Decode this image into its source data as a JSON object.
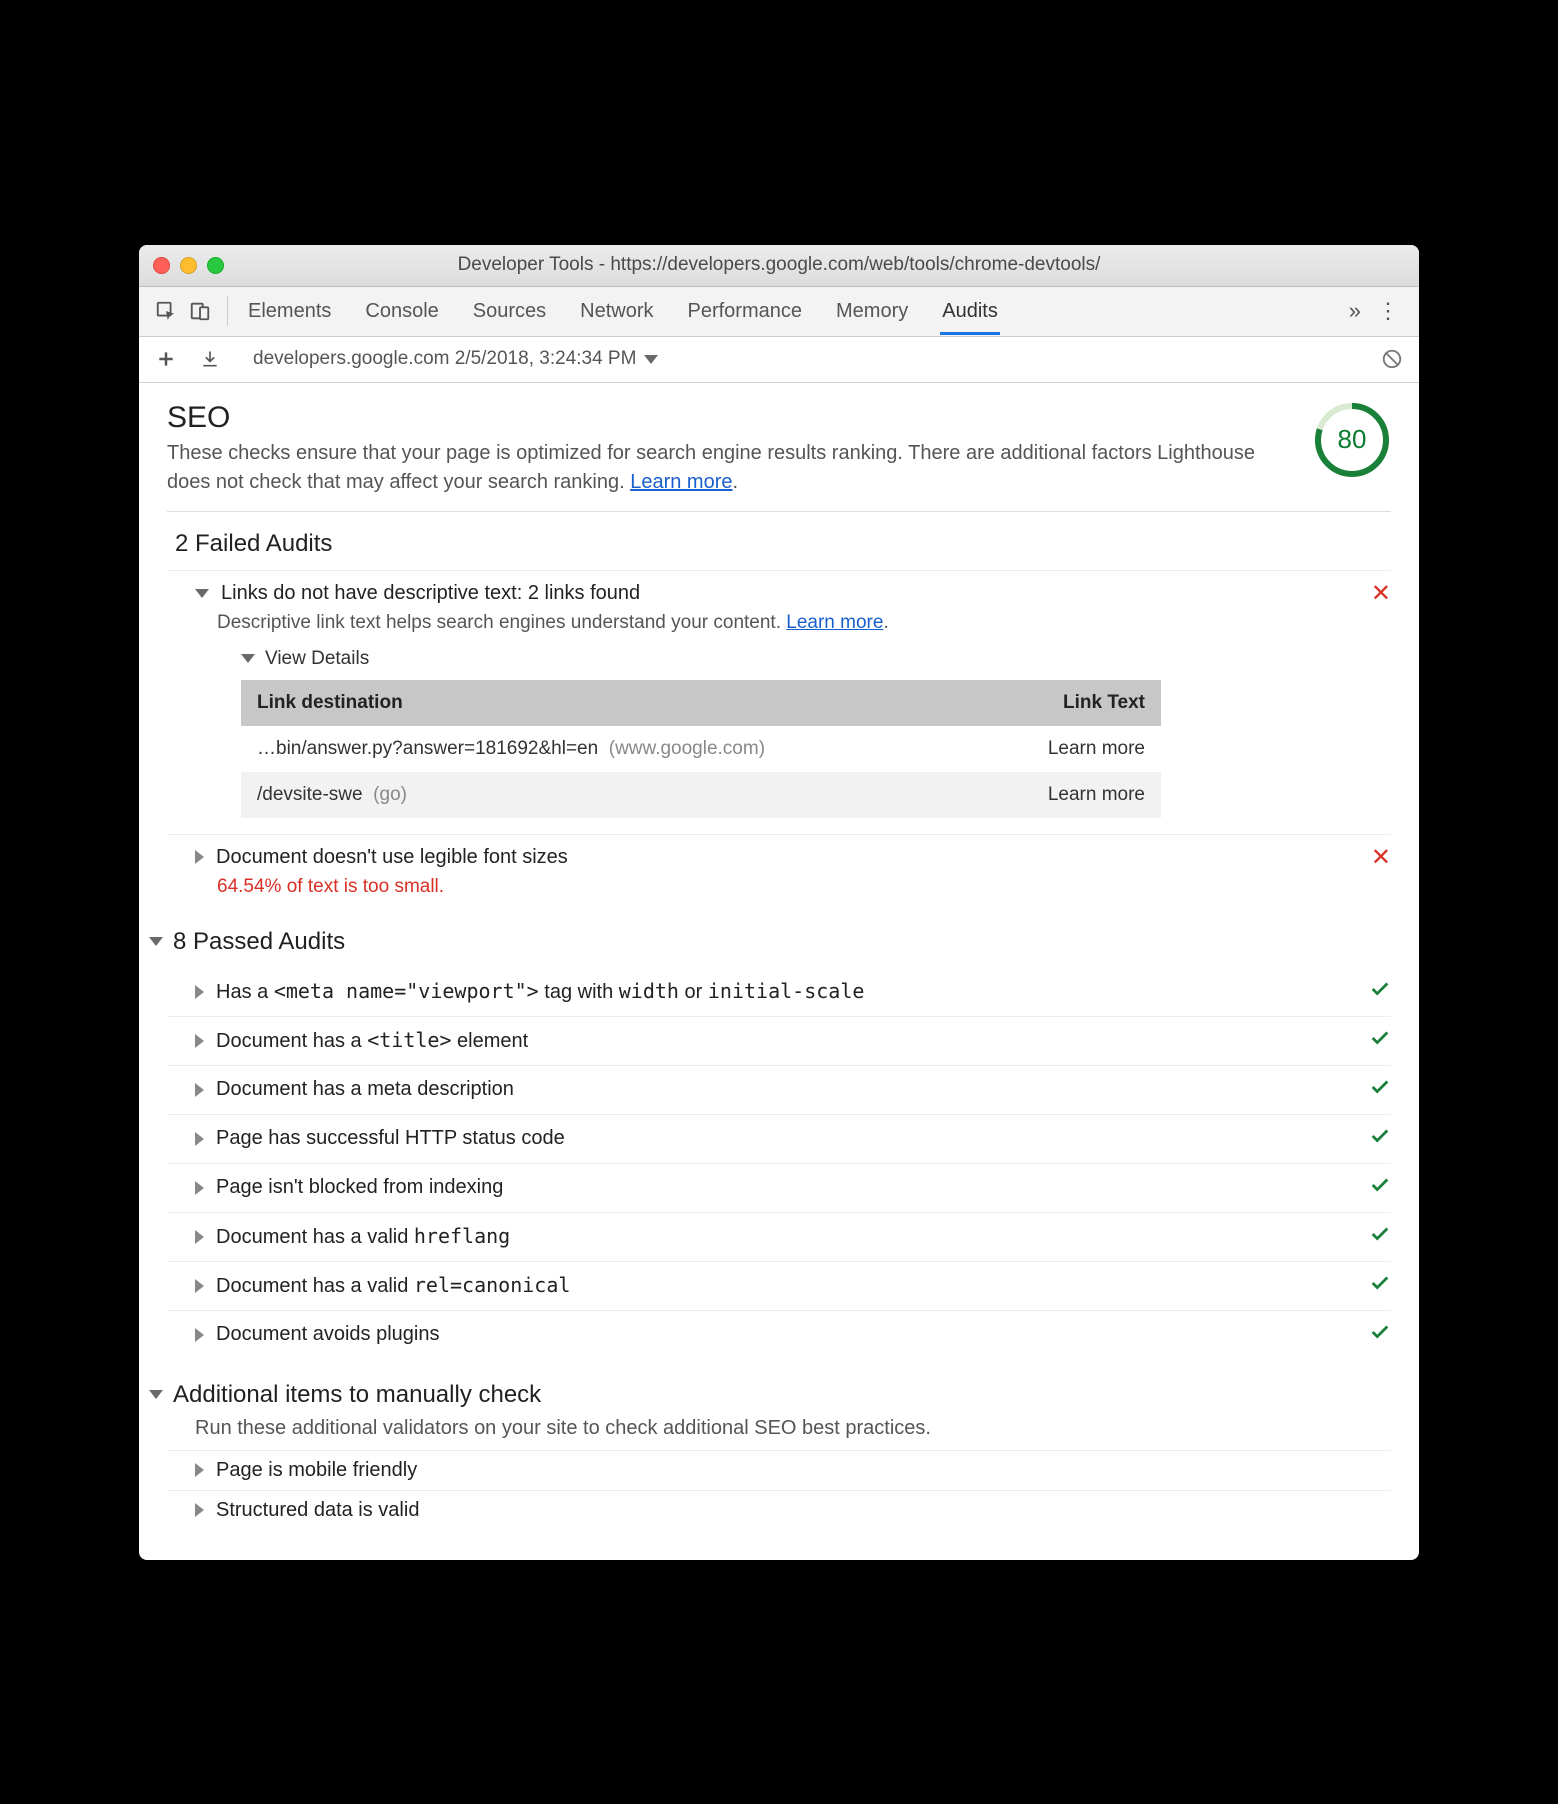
{
  "window": {
    "title": "Developer Tools - https://developers.google.com/web/tools/chrome-devtools/"
  },
  "tabs": {
    "items": [
      "Elements",
      "Console",
      "Sources",
      "Network",
      "Performance",
      "Memory",
      "Audits"
    ],
    "active": "Audits",
    "overflow": "»",
    "kebab": "⋮"
  },
  "subbar": {
    "report": "developers.google.com 2/5/2018, 3:24:34 PM"
  },
  "seo": {
    "title": "SEO",
    "desc_prefix": "These checks ensure that your page is optimized for search engine results ranking. There are additional factors Lighthouse does not check that may affect your search ranking. ",
    "learn_more": "Learn more",
    "score": "80"
  },
  "failed": {
    "heading": "2 Failed Audits",
    "items": [
      {
        "title": "Links do not have descriptive text: 2 links found",
        "sub_prefix": "Descriptive link text helps search engines understand your content. ",
        "learn_more": "Learn more",
        "expanded": true,
        "view_details": "View Details",
        "table": {
          "col1": "Link destination",
          "col2": "Link Text",
          "rows": [
            {
              "dest": "…bin/answer.py?answer=181692&hl=en",
              "host": "(www.google.com)",
              "text": "Learn more"
            },
            {
              "dest": "/devsite-swe",
              "host": "(go)",
              "text": "Learn more"
            }
          ]
        }
      },
      {
        "title": "Document doesn't use legible font sizes",
        "note": "64.54% of text is too small.",
        "expanded": false
      }
    ]
  },
  "passed": {
    "heading": "8 Passed Audits",
    "items": [
      {
        "pre": "Has a ",
        "code1": "<meta name=\"viewport\">",
        "mid": " tag with ",
        "code2": "width",
        "mid2": " or ",
        "code3": "initial-scale"
      },
      {
        "pre": "Document has a ",
        "code1": "<title>",
        "mid": " element"
      },
      {
        "pre": "Document has a meta description"
      },
      {
        "pre": "Page has successful HTTP status code"
      },
      {
        "pre": "Page isn't blocked from indexing"
      },
      {
        "pre": "Document has a valid ",
        "code1": "hreflang"
      },
      {
        "pre": "Document has a valid ",
        "code1": "rel=canonical"
      },
      {
        "pre": "Document avoids plugins"
      }
    ]
  },
  "manual": {
    "heading": "Additional items to manually check",
    "desc": "Run these additional validators on your site to check additional SEO best practices.",
    "items": [
      "Page is mobile friendly",
      "Structured data is valid"
    ]
  }
}
